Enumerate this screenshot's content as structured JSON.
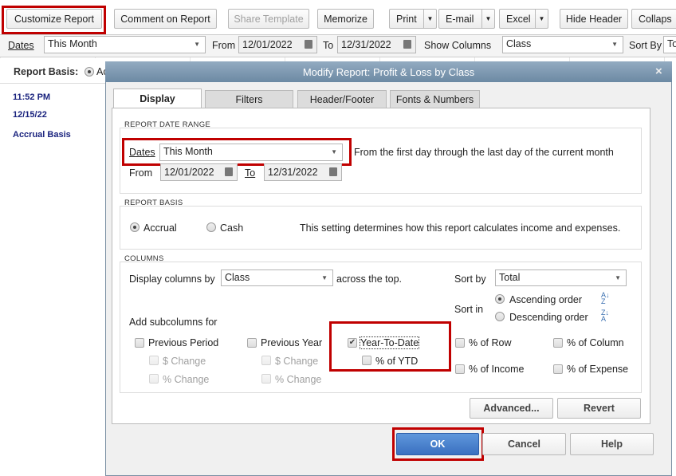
{
  "toolbar": {
    "customize": "Customize Report",
    "comment": "Comment on Report",
    "share": "Share Template",
    "memorize": "Memorize",
    "print": "Print",
    "email": "E-mail",
    "excel": "Excel",
    "hide_header": "Hide Header",
    "collapse": "Collaps"
  },
  "filterbar": {
    "dates_label": "Dates",
    "dates_value": "This Month",
    "from_label": "From",
    "from_value": "12/01/2022",
    "to_label": "To",
    "to_value": "12/31/2022",
    "show_columns_label": "Show Columns",
    "show_columns_value": "Class",
    "sort_by_label": "Sort By",
    "sort_by_value": "To"
  },
  "report": {
    "basis_label": "Report Basis:",
    "basis_value": "Ac",
    "time": "11:52 PM",
    "date": "12/15/22",
    "basis_text": "Accrual Basis"
  },
  "dialog": {
    "title": "Modify Report: Profit & Loss by Class",
    "close": "×",
    "tabs": [
      "Display",
      "Filters",
      "Header/Footer",
      "Fonts & Numbers"
    ],
    "date_range": {
      "section": "REPORT DATE RANGE",
      "dates_label": "Dates",
      "dates_value": "This Month",
      "description": "From the first day through the last day of the current month",
      "from_label": "From",
      "from_value": "12/01/2022",
      "to_label": "To",
      "to_value": "12/31/2022"
    },
    "basis": {
      "section": "REPORT BASIS",
      "accrual": "Accrual",
      "cash": "Cash",
      "description": "This setting determines how this report calculates income and expenses."
    },
    "columns": {
      "section": "COLUMNS",
      "display_by_label": "Display columns by",
      "display_by_value": "Class",
      "across": "across the top.",
      "sort_by_label": "Sort by",
      "sort_by_value": "Total",
      "sort_in_label": "Sort in",
      "ascending": "Ascending order",
      "descending": "Descending order",
      "add_sub_label": "Add subcolumns for",
      "previous_period": "Previous Period",
      "previous_year": "Previous Year",
      "dollar_change": "$ Change",
      "pct_change": "% Change",
      "ytd": "Year-To-Date",
      "pct_ytd": "% of YTD",
      "pct_row": "% of Row",
      "pct_column": "% of Column",
      "pct_income": "% of Income",
      "pct_expense": "% of Expense"
    },
    "buttons": {
      "advanced": "Advanced...",
      "revert": "Revert",
      "ok": "OK",
      "cancel": "Cancel",
      "help": "Help"
    }
  }
}
